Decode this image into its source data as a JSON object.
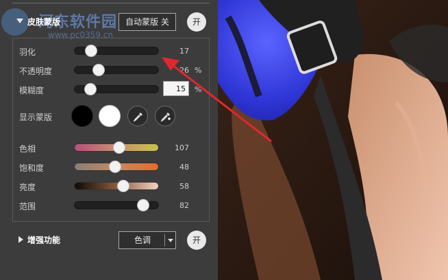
{
  "panel": {
    "mask_section": {
      "title": "皮肤蒙版",
      "auto_mask_button": "自动蒙版 关",
      "toggle_button": "开",
      "sliders": [
        {
          "label": "羽化",
          "value": "17",
          "unit": "",
          "fraction": 0.2
        },
        {
          "label": "不透明度",
          "value": "26",
          "unit": "%",
          "fraction": 0.29
        },
        {
          "label": "模糊度",
          "value": "15",
          "unit": "%",
          "fraction": 0.19
        }
      ],
      "show_mask_label": "显示蒙版",
      "color_sliders": [
        {
          "label": "色相",
          "value": "107",
          "fraction": 0.53
        },
        {
          "label": "饱和度",
          "value": "48",
          "fraction": 0.48
        },
        {
          "label": "亮度",
          "value": "58",
          "fraction": 0.58
        },
        {
          "label": "范围",
          "value": "82",
          "fraction": 0.82
        }
      ],
      "swatches": [
        "#000000",
        "#ffffff"
      ]
    },
    "enhance_section": {
      "title": "增强功能",
      "dropdown_value": "色调",
      "toggle_button": "开"
    }
  },
  "watermark": {
    "text": "河东软件园",
    "url": "www.pc0359.cn"
  },
  "colors": {
    "panel_bg": "#3c3c3c",
    "annotation_arrow": "#e0282e",
    "helmet_blue": "#2f36d6"
  },
  "icons": [
    "eyedropper-icon",
    "eyedropper-plus-icon",
    "expand-arrow-icon",
    "collapsed-arrow-icon",
    "dropdown-caret-icon"
  ]
}
